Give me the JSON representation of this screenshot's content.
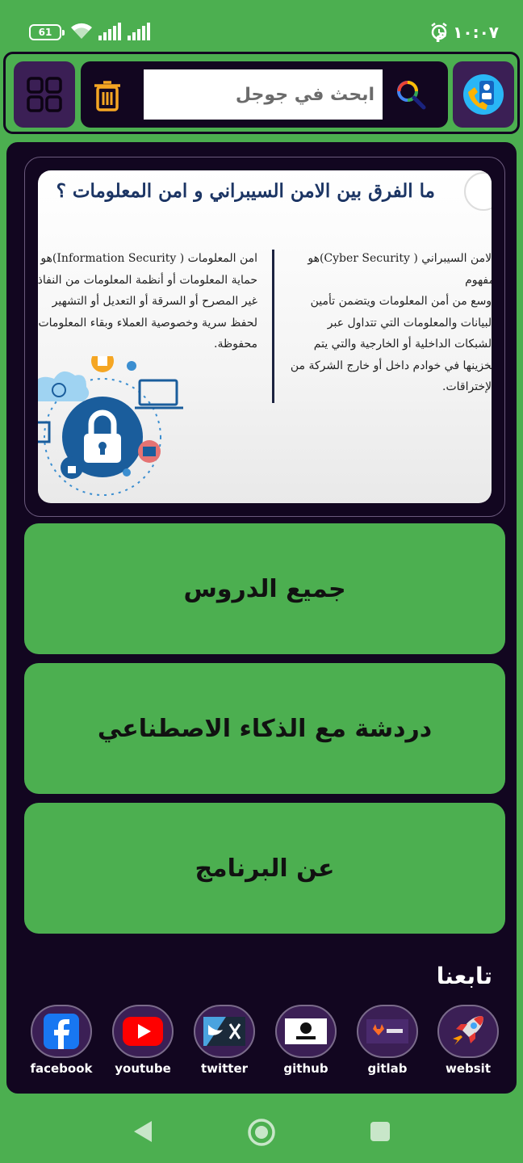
{
  "status_bar": {
    "battery": "61",
    "time": "١٠:٠٧ م"
  },
  "top_bar": {
    "search_placeholder": "ابحث في جوجل",
    "icons": [
      "grid-icon",
      "trash-icon",
      "search-icon",
      "contacts-icon"
    ]
  },
  "banner": {
    "title": "ما الفرق بين الامن السيبراني و امن المعلومات ؟",
    "right_text": "الامن السيبراني ( Cyber Security)هو مفهوم\nأوسع من أمن المعلومات ويتضمن تأمين\nالبيانات والمعلومات التي تتداول عبر\nالشبكات الداخلية أو الخارجية والتي يتم\nتخزينها في خوادم داخل أو خارج الشركة من\nالإختراقات.",
    "left_text": "امن المعلومات ( Information Security)هو\nحماية المعلومات أو أنظمة المعلومات من النفاذ\nغير المصرح أو السرقة أو التعديل أو التشهير\nلحفظ سرية وخصوصية العملاء وبقاء المعلومات\nمحفوظة."
  },
  "menu": {
    "all_lessons": "جميع الدروس",
    "ai_chat": "دردشة مع الذكاء الاصطناعي",
    "about": "عن البرنامج"
  },
  "follow": {
    "title": "تابعنا",
    "links": [
      {
        "label": "facebook",
        "icon": "facebook-icon"
      },
      {
        "label": "youtube",
        "icon": "youtube-icon"
      },
      {
        "label": "twitter",
        "icon": "twitter-icon"
      },
      {
        "label": "github",
        "icon": "github-icon"
      },
      {
        "label": "gitlab",
        "icon": "gitlab-icon"
      },
      {
        "label": "websit",
        "icon": "rocket-icon"
      }
    ]
  },
  "colors": {
    "accent_green": "#4caf50",
    "dark_bg": "#120620",
    "button_purple": "#3b1f55"
  }
}
